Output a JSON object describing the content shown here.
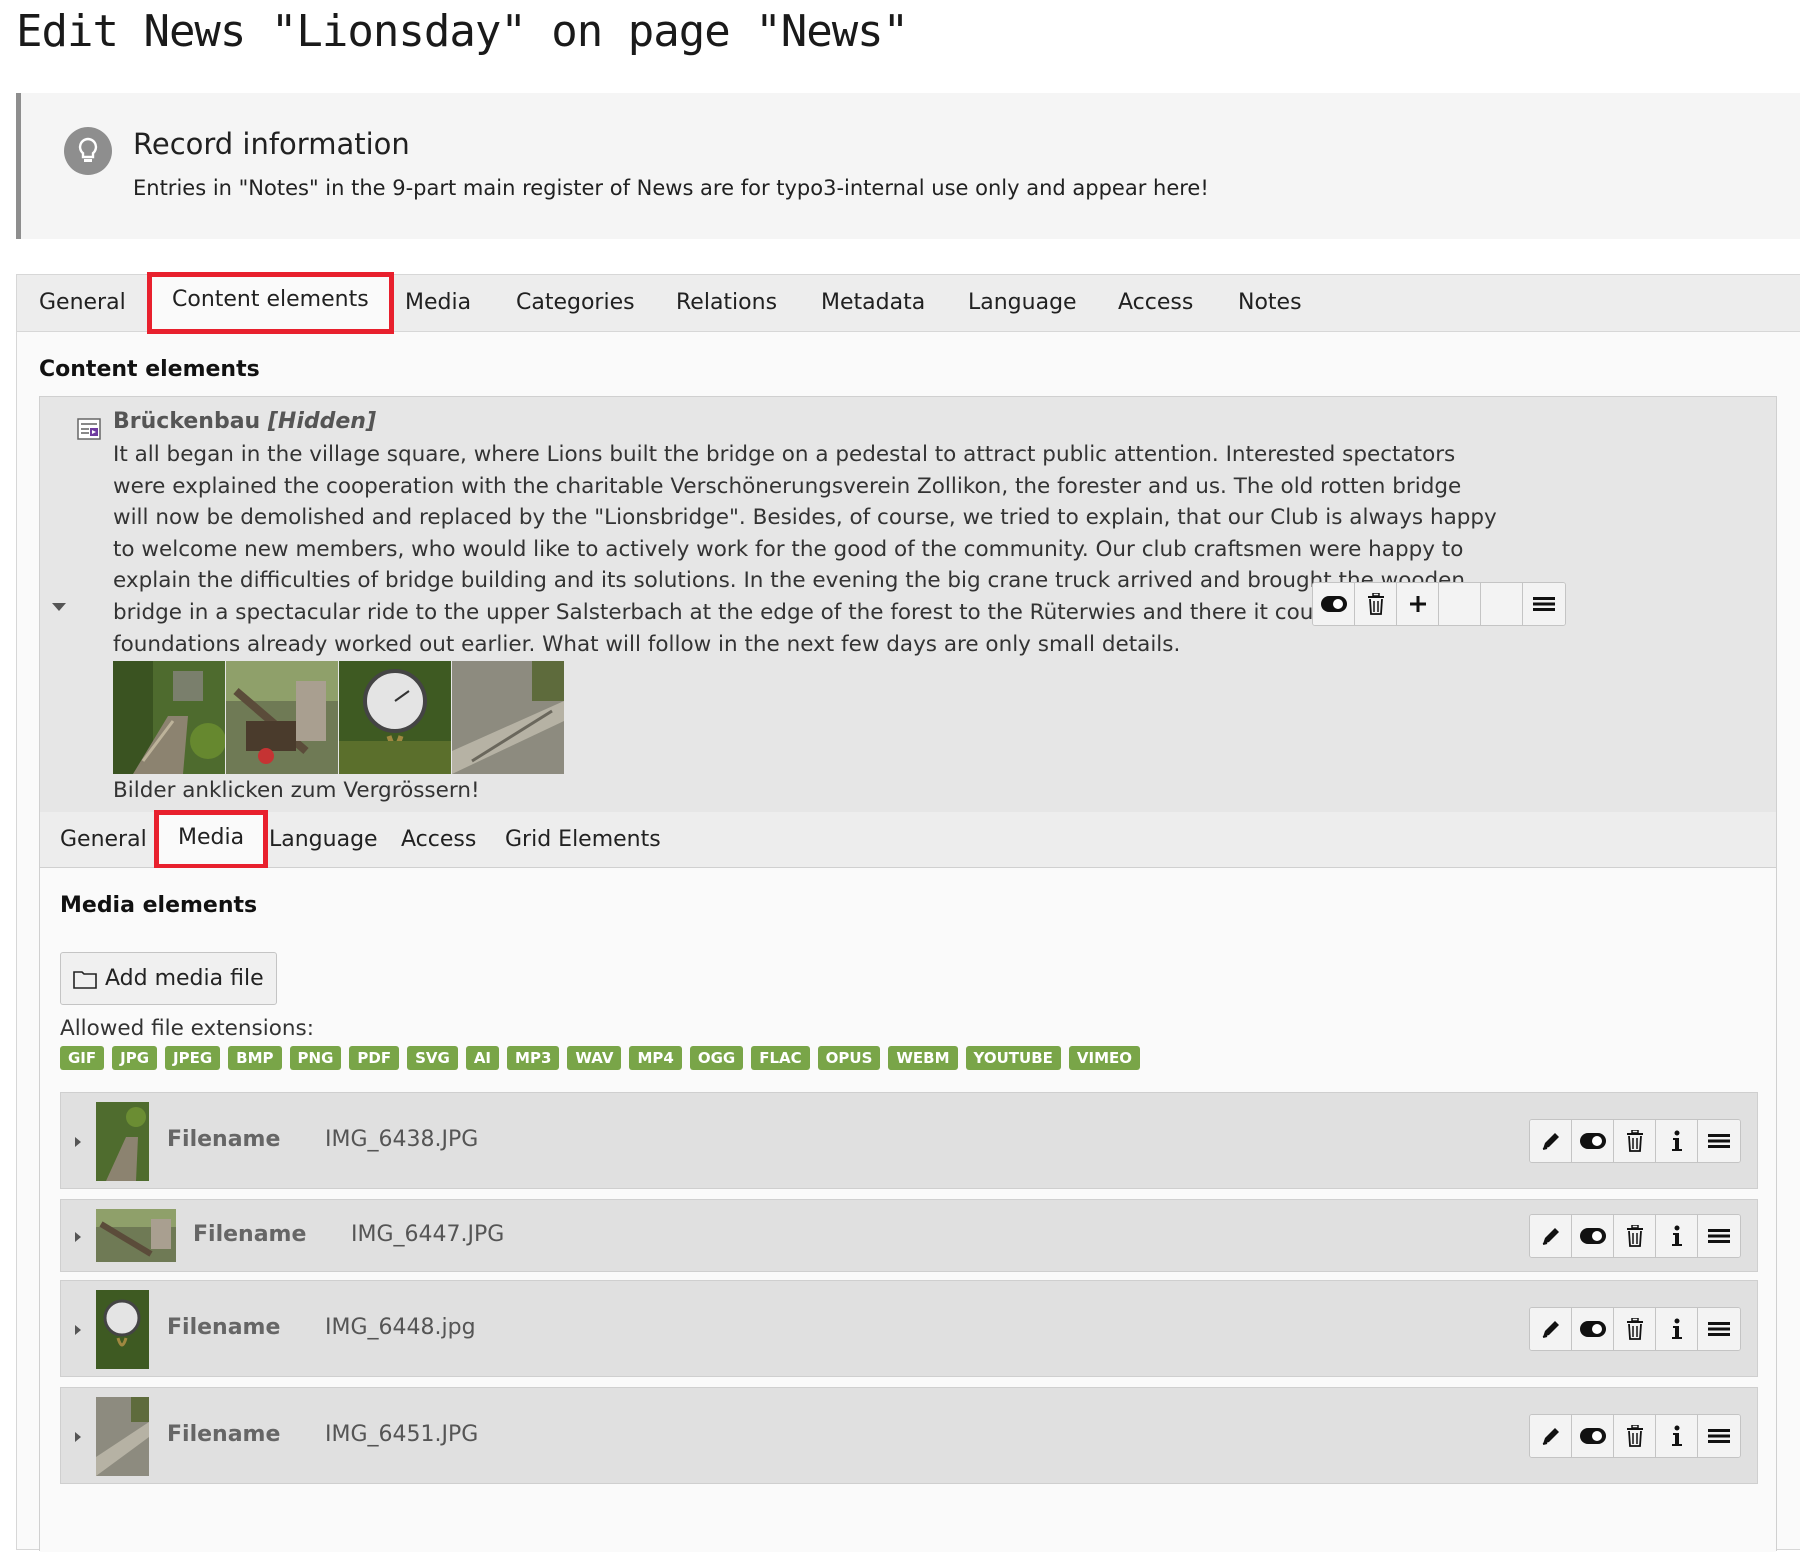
{
  "page_title": "Edit News \"Lionsday\" on page \"News\"",
  "record_info": {
    "heading": "Record information",
    "text": "Entries in \"Notes\" in the 9-part main register of News are for typo3-internal use only and appear here!"
  },
  "main_tabs": [
    "General",
    "Content elements",
    "Media",
    "Categories",
    "Relations",
    "Metadata",
    "Language",
    "Access",
    "Notes"
  ],
  "active_main_tab": "Content elements",
  "section_title": "Content elements",
  "content_element": {
    "title": "Brückenbau",
    "hidden_label": "[Hidden]",
    "text_lines": [
      "It all began in the village square, where Lions built the bridge on a pedestal to attract public attention. Interested spectators",
      "were explained the cooperation with the charitable Verschönerungsverein Zollikon, the forester and us. The old rotten bridge",
      "will now be demolished and replaced by the \"Lionsbridge\". Besides, of course, we tried to explain, that our Club is always happy",
      "to welcome new members, who would like to actively work for the good of the community. Our club craftsmen were happy to",
      "explain the difficulties of bridge building and its solutions. In the evening the big crane truck arrived and brought the wooden",
      "bridge in a spectacular ride to the upper Salsterbach at the edge of the forest to the Rüterwies and there it could be set into the",
      "foundations already worked out earlier. What will follow in the next few days are only small details."
    ],
    "caption": "Bilder anklicken zum Vergrössern!",
    "actions": [
      "toggle-visibility-icon",
      "delete-icon",
      "add-icon",
      "blank",
      "blank",
      "menu-icon"
    ]
  },
  "inner_tabs": [
    "General",
    "Media",
    "Language",
    "Access",
    "Grid Elements"
  ],
  "active_inner_tab": "Media",
  "media": {
    "section_title": "Media elements",
    "add_button": "Add media file",
    "allowed_label": "Allowed file extensions:",
    "extensions": [
      "GIF",
      "JPG",
      "JPEG",
      "BMP",
      "PNG",
      "PDF",
      "SVG",
      "AI",
      "MP3",
      "WAV",
      "MP4",
      "OGG",
      "FLAC",
      "OPUS",
      "WEBM",
      "YOUTUBE",
      "VIMEO"
    ],
    "extension_color": "#79a548",
    "files": [
      {
        "label": "Filename",
        "value": "IMG_6438.JPG"
      },
      {
        "label": "Filename",
        "value": "IMG_6447.JPG"
      },
      {
        "label": "Filename",
        "value": "IMG_6448.jpg"
      },
      {
        "label": "Filename",
        "value": "IMG_6451.JPG"
      }
    ]
  },
  "colors": {
    "highlight": "#e8202d",
    "info_bar": "#8e8e8e"
  }
}
